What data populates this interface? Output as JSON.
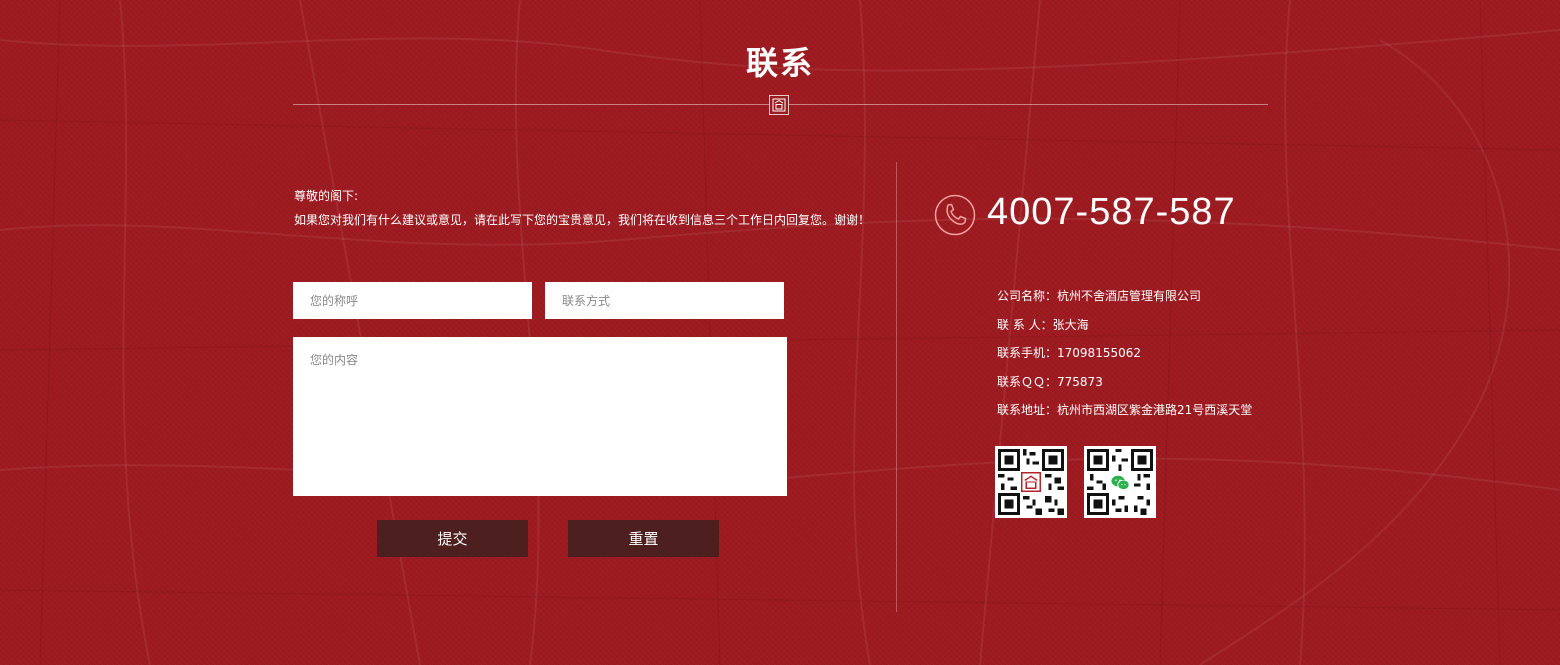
{
  "header": {
    "title": "联系"
  },
  "intro": {
    "greeting": "尊敬的阁下:",
    "message": "如果您对我们有什么建议或意见，请在此写下您的宝贵意见，我们将在收到信息三个工作日内回复您。谢谢！"
  },
  "form": {
    "name_placeholder": "您的称呼",
    "contact_placeholder": "联系方式",
    "content_placeholder": "您的内容",
    "submit_label": "提交",
    "reset_label": "重置"
  },
  "contact": {
    "phone": "4007-587-587",
    "rows": [
      {
        "label": "公司名称：",
        "value": "杭州不舍酒店管理有限公司"
      },
      {
        "label": "联 系 人：",
        "value": "张大海"
      },
      {
        "label": "联系手机：",
        "value": "17098155062"
      },
      {
        "label": "联系ＱＱ：",
        "value": "775873"
      },
      {
        "label": "联系地址：",
        "value": "杭州市西湖区紫金港路21号西溪天堂"
      }
    ]
  },
  "colors": {
    "background": "#9c1a20",
    "button": "#4d1f1e",
    "text": "#ffffff"
  },
  "icons": [
    "map-background",
    "logo-emblem-icon",
    "phone-icon",
    "qr-code-icon",
    "wechat-icon"
  ]
}
